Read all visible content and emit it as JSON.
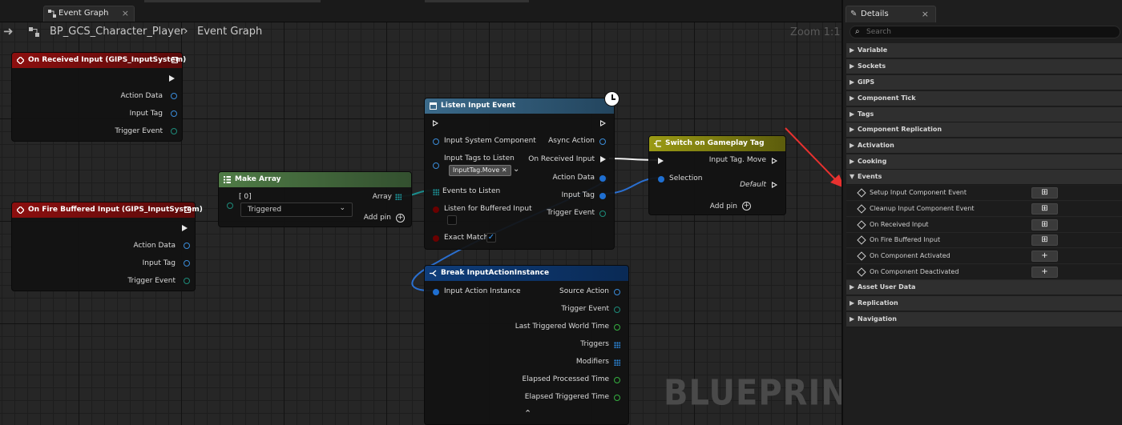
{
  "tab": {
    "title": "Event Graph",
    "close": "×"
  },
  "breadcrumb": {
    "blueprint": "BP_GCS_Character_Player",
    "separator": "›",
    "graph": "Event Graph"
  },
  "zoom": "Zoom 1:1",
  "watermark": "BLUEPRINT",
  "nodes": {
    "on_received": {
      "title": "On Received Input (GIPS_InputSystem)",
      "pins": [
        "Action Data",
        "Input Tag",
        "Trigger Event"
      ]
    },
    "on_fire_buffered": {
      "title": "On Fire Buffered Input (GIPS_InputSystem)",
      "pins": [
        "Action Data",
        "Input Tag",
        "Trigger Event"
      ]
    },
    "make_array": {
      "title": "Make Array",
      "index_label": "[ 0]",
      "dropdown_value": "Triggered",
      "array_label": "Array",
      "add_pin": "Add pin"
    },
    "listen_input": {
      "title": "Listen Input Event",
      "left_pins": [
        "Input System Component",
        "Input Tags to Listen",
        "Events to Listen",
        "Listen for Buffered Input",
        "Exact Match"
      ],
      "tag_chip": "InputTag.Move",
      "right_pins": [
        "Async Action",
        "On Received Input",
        "Action Data",
        "Input Tag",
        "Trigger Event"
      ]
    },
    "switch_tag": {
      "title": "Switch on Gameplay Tag",
      "selection": "Selection",
      "case": "Input Tag. Move",
      "default": "Default",
      "add_pin": "Add pin"
    },
    "break_instance": {
      "title": "Break InputActionInstance",
      "input": "Input Action Instance",
      "outputs": [
        "Source Action",
        "Trigger Event",
        "Last Triggered World Time",
        "Triggers",
        "Modifiers",
        "Elapsed Processed Time",
        "Elapsed Triggered Time"
      ]
    }
  },
  "details": {
    "tab_title": "Details",
    "close": "×",
    "search_placeholder": "Search",
    "categories_top": [
      "Variable",
      "Sockets",
      "GIPS",
      "Component Tick",
      "Tags",
      "Component Replication",
      "Activation",
      "Cooking"
    ],
    "events_label": "Events",
    "events": [
      {
        "label": "Setup Input Component Event",
        "button": "⊞"
      },
      {
        "label": "Cleanup Input Component Event",
        "button": "⊞"
      },
      {
        "label": "On Received Input",
        "button": "⊞"
      },
      {
        "label": "On Fire Buffered Input",
        "button": "⊞"
      },
      {
        "label": "On Component Activated",
        "button": "+"
      },
      {
        "label": "On Component Deactivated",
        "button": "+"
      }
    ],
    "categories_bottom": [
      "Asset User Data",
      "Replication",
      "Navigation"
    ]
  },
  "colors": {
    "accent_red": "#8c0f0f",
    "accent_green": "#4f7b46",
    "accent_blue": "#3b6a8a",
    "accent_olive": "#9a9a14",
    "accent_navy": "#0f3d7a",
    "annotation_arrow": "#e8312f"
  }
}
